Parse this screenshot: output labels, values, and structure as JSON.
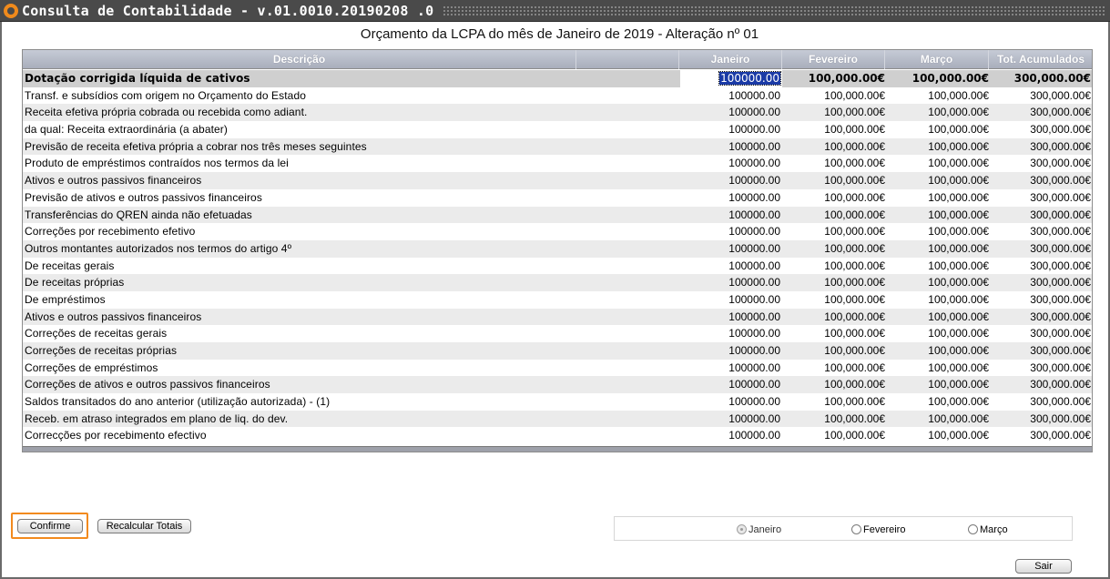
{
  "window": {
    "title": "Consulta de Contabilidade - v.01.0010.20190208 .0"
  },
  "heading": "Orçamento da LCPA do mês de Janeiro   de 2019 - Alteração nº 01",
  "grid": {
    "columns": [
      "Descrição",
      "Janeiro",
      "Fevereiro",
      "Março",
      "Tot. Acumulados"
    ],
    "rows": [
      {
        "desc": "Dotação corrigida líquida de cativos",
        "jan": "100000.00",
        "fev": "100,000.00€",
        "mar": "100,000.00€",
        "tot": "300,000.00€"
      },
      {
        "desc": "Transf. e subsídios com origem no Orçamento do Estado",
        "jan": "100000.00",
        "fev": "100,000.00€",
        "mar": "100,000.00€",
        "tot": "300,000.00€"
      },
      {
        "desc": "Receita efetiva própria cobrada ou recebida como adiant.",
        "jan": "100000.00",
        "fev": "100,000.00€",
        "mar": "100,000.00€",
        "tot": "300,000.00€"
      },
      {
        "desc": "da qual: Receita extraordinária (a abater)",
        "jan": "100000.00",
        "fev": "100,000.00€",
        "mar": "100,000.00€",
        "tot": "300,000.00€"
      },
      {
        "desc": "Previsão de receita efetiva própria a cobrar nos três meses seguintes",
        "jan": "100000.00",
        "fev": "100,000.00€",
        "mar": "100,000.00€",
        "tot": "300,000.00€"
      },
      {
        "desc": "Produto de empréstimos contraídos nos termos da lei",
        "jan": "100000.00",
        "fev": "100,000.00€",
        "mar": "100,000.00€",
        "tot": "300,000.00€"
      },
      {
        "desc": "Ativos e outros passivos financeiros",
        "jan": "100000.00",
        "fev": "100,000.00€",
        "mar": "100,000.00€",
        "tot": "300,000.00€"
      },
      {
        "desc": "Previsão de ativos e outros passivos financeiros",
        "jan": "100000.00",
        "fev": "100,000.00€",
        "mar": "100,000.00€",
        "tot": "300,000.00€"
      },
      {
        "desc": "Transferências do QREN ainda não efetuadas",
        "jan": "100000.00",
        "fev": "100,000.00€",
        "mar": "100,000.00€",
        "tot": "300,000.00€"
      },
      {
        "desc": "Correções por recebimento efetivo",
        "jan": "100000.00",
        "fev": "100,000.00€",
        "mar": "100,000.00€",
        "tot": "300,000.00€"
      },
      {
        "desc": "Outros montantes autorizados nos termos do artigo 4º",
        "jan": "100000.00",
        "fev": "100,000.00€",
        "mar": "100,000.00€",
        "tot": "300,000.00€"
      },
      {
        "desc": "De receitas gerais",
        "jan": "100000.00",
        "fev": "100,000.00€",
        "mar": "100,000.00€",
        "tot": "300,000.00€"
      },
      {
        "desc": "De receitas próprias",
        "jan": "100000.00",
        "fev": "100,000.00€",
        "mar": "100,000.00€",
        "tot": "300,000.00€"
      },
      {
        "desc": "De empréstimos",
        "jan": "100000.00",
        "fev": "100,000.00€",
        "mar": "100,000.00€",
        "tot": "300,000.00€"
      },
      {
        "desc": "Ativos e outros passivos financeiros",
        "jan": "100000.00",
        "fev": "100,000.00€",
        "mar": "100,000.00€",
        "tot": "300,000.00€"
      },
      {
        "desc": "Correções de receitas gerais",
        "jan": "100000.00",
        "fev": "100,000.00€",
        "mar": "100,000.00€",
        "tot": "300,000.00€"
      },
      {
        "desc": "Correções de receitas próprias",
        "jan": "100000.00",
        "fev": "100,000.00€",
        "mar": "100,000.00€",
        "tot": "300,000.00€"
      },
      {
        "desc": "Correções de empréstimos",
        "jan": "100000.00",
        "fev": "100,000.00€",
        "mar": "100,000.00€",
        "tot": "300,000.00€"
      },
      {
        "desc": "Correções de ativos e outros passivos financeiros",
        "jan": "100000.00",
        "fev": "100,000.00€",
        "mar": "100,000.00€",
        "tot": "300,000.00€"
      },
      {
        "desc": "Saldos transitados do ano anterior (utilização autorizada) - (1)",
        "jan": "100000.00",
        "fev": "100,000.00€",
        "mar": "100,000.00€",
        "tot": "300,000.00€"
      },
      {
        "desc": "Receb. em atraso integrados em plano de liq. do dev.",
        "jan": "100000.00",
        "fev": "100,000.00€",
        "mar": "100,000.00€",
        "tot": "300,000.00€"
      },
      {
        "desc": "Correcções por recebimento efectivo",
        "jan": "100000.00",
        "fev": "100,000.00€",
        "mar": "100,000.00€",
        "tot": "300,000.00€"
      }
    ]
  },
  "buttons": {
    "confirm": "Confirme",
    "recalc": "Recalcular Totais",
    "exit": "Sair"
  },
  "month_selector": {
    "options": [
      "Janeiro",
      "Fevereiro",
      "Março"
    ],
    "selected": "Janeiro"
  },
  "colors": {
    "titlebar": "#4a4a4a",
    "accent": "#f28a1e",
    "selection": "#1a3aa6",
    "header": "#a9aebc"
  }
}
